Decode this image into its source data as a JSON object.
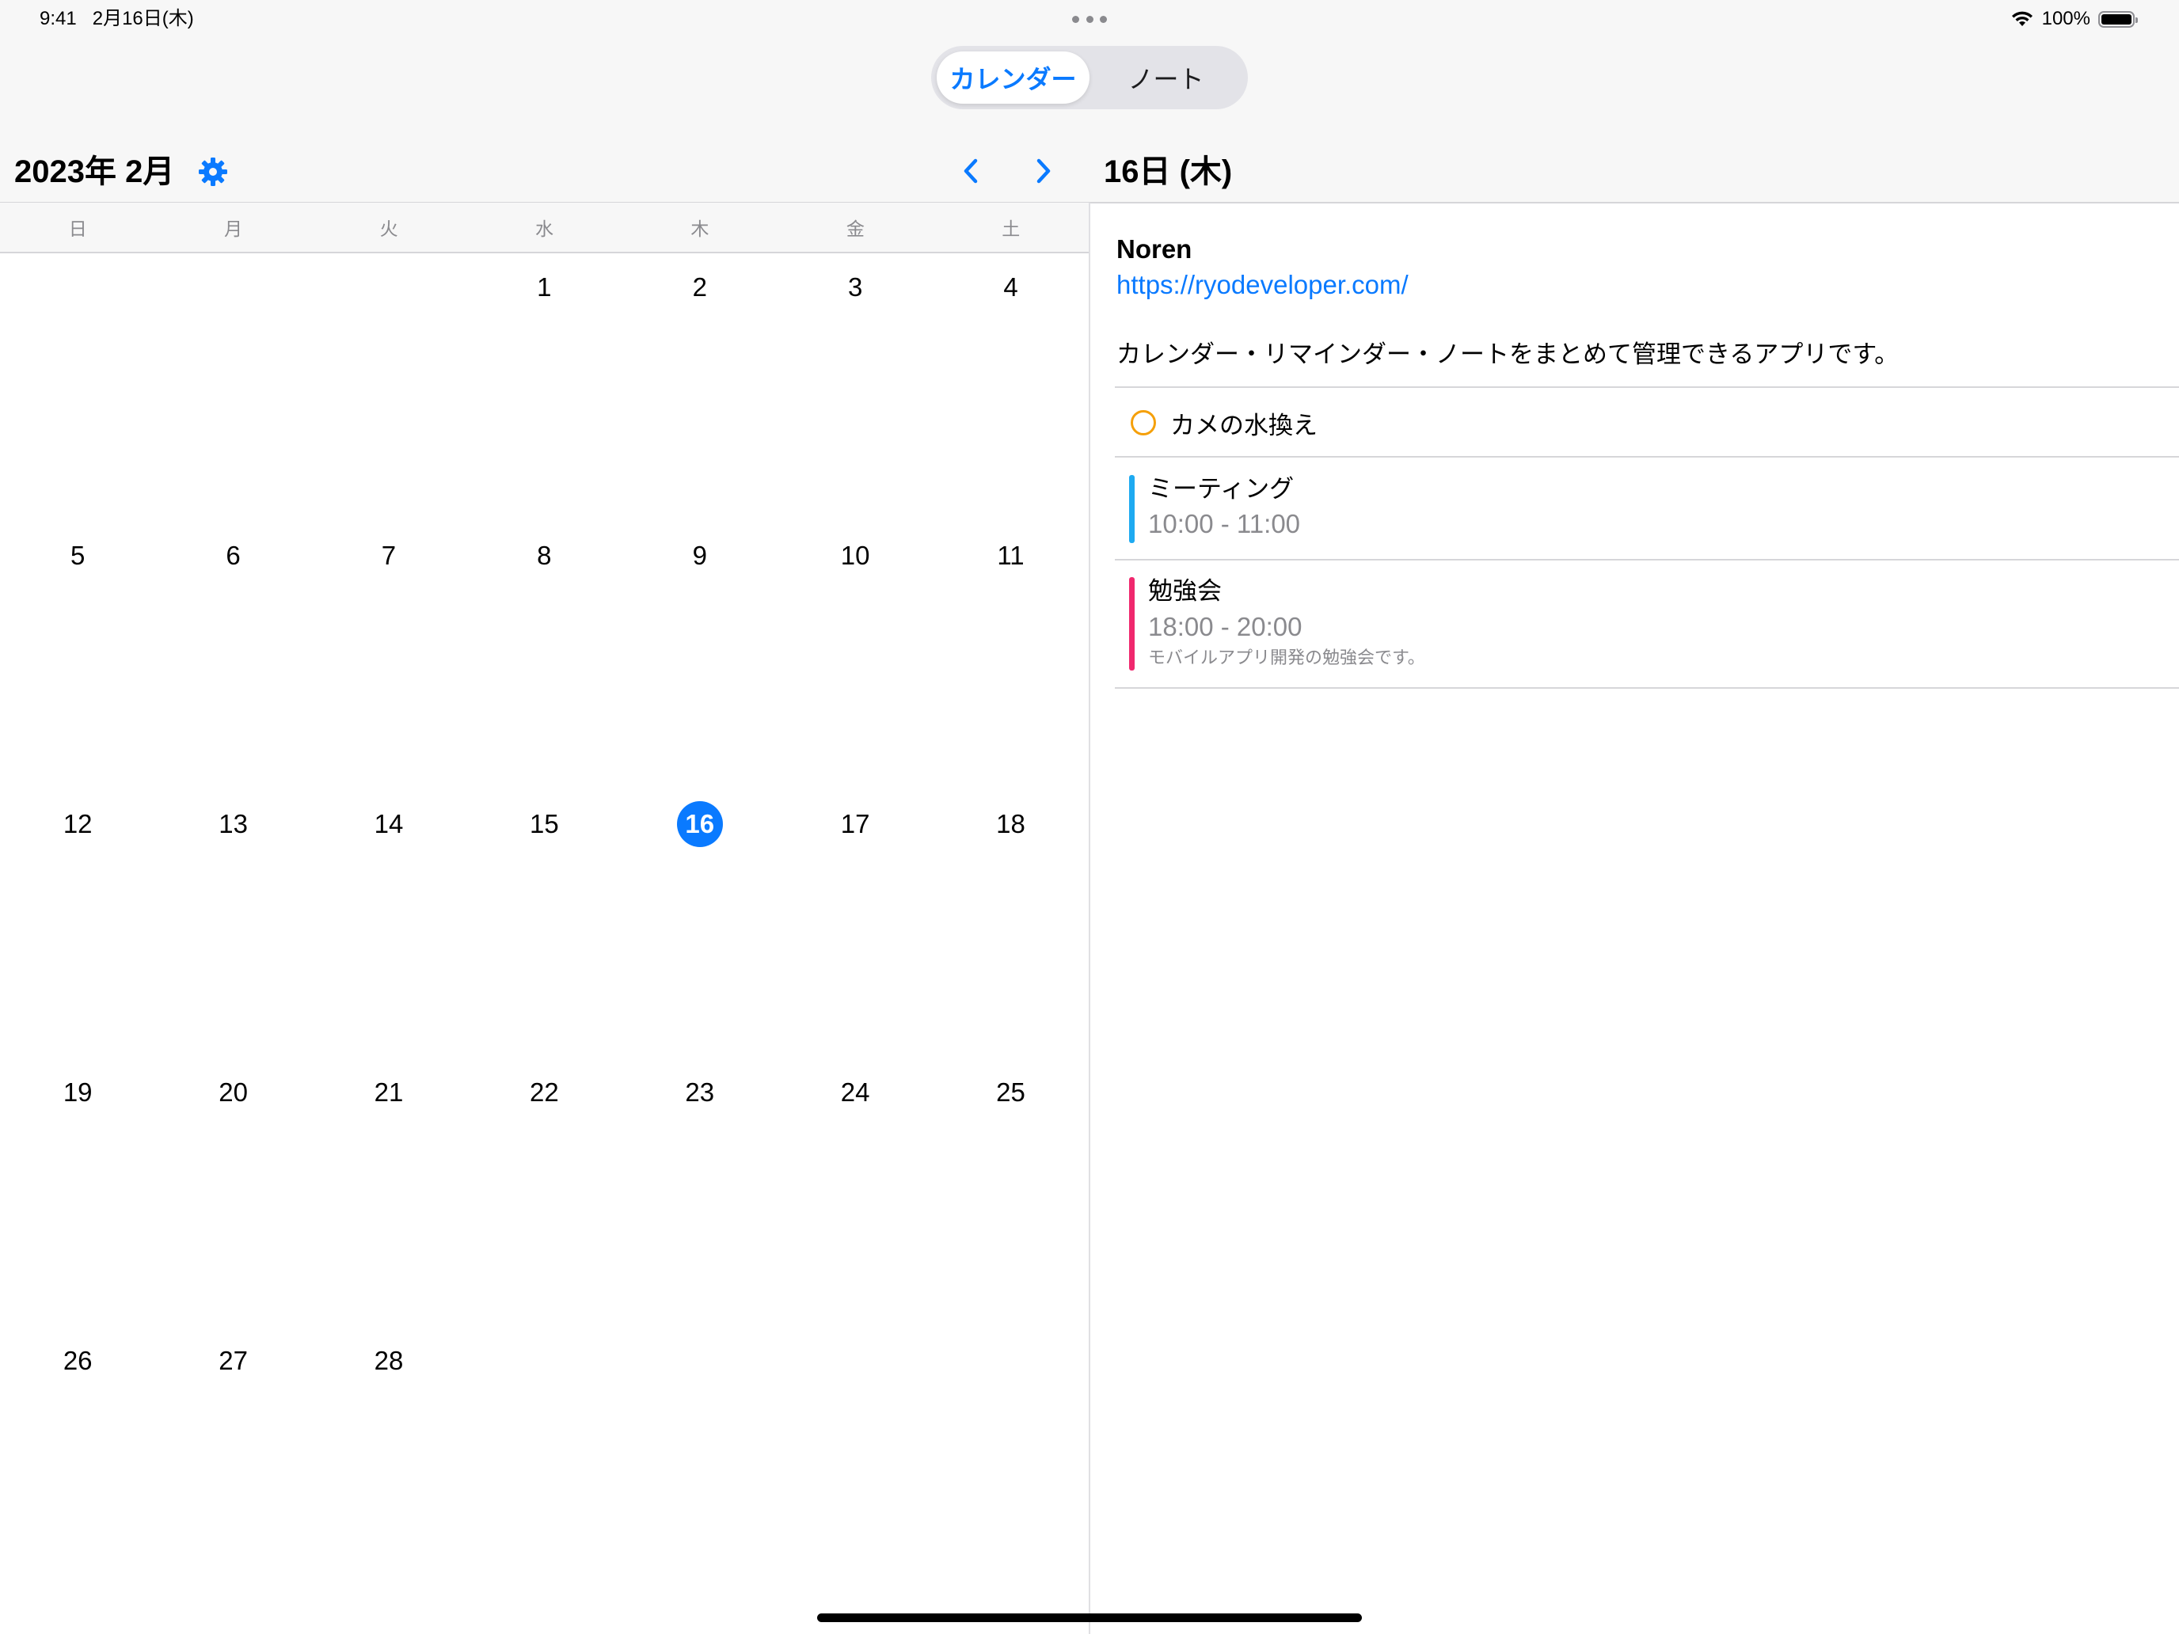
{
  "status_bar": {
    "time": "9:41",
    "date": "2月16日(木)",
    "battery": "100%",
    "battery_level": 1.0
  },
  "segmented_control": {
    "options": [
      "カレンダー",
      "ノート"
    ],
    "selected": "カレンダー"
  },
  "calendar": {
    "month_title": "2023年 2月",
    "weekdays": [
      "日",
      "月",
      "火",
      "水",
      "木",
      "金",
      "土"
    ],
    "weeks": [
      [
        "",
        "",
        "",
        "1",
        "2",
        "3",
        "4"
      ],
      [
        "5",
        "6",
        "7",
        "8",
        "9",
        "10",
        "11"
      ],
      [
        "12",
        "13",
        "14",
        "15",
        "16",
        "17",
        "18"
      ],
      [
        "19",
        "20",
        "21",
        "22",
        "23",
        "24",
        "25"
      ],
      [
        "26",
        "27",
        "28",
        "",
        "",
        "",
        ""
      ]
    ],
    "selected_day": "16"
  },
  "detail": {
    "date_title": "16日 (木)",
    "note": {
      "title": "Noren",
      "link": "https://ryodeveloper.com/",
      "description": "カレンダー・リマインダー・ノートをまとめて管理できるアプリです。"
    },
    "reminder": {
      "title": "カメの水換え",
      "color": "#f5a00a"
    },
    "events": [
      {
        "title": "ミーティング",
        "time": "10:00 - 11:00",
        "note": "",
        "color": "#1eaaf1"
      },
      {
        "title": "勉強会",
        "time": "18:00 - 20:00",
        "note": "モバイルアプリ開発の勉強会です。",
        "color": "#f0286e"
      }
    ]
  },
  "colors": {
    "accent": "#0a7aff",
    "separator": "#d6d6d9",
    "secondary_text": "#8a8a8e"
  },
  "icons": {
    "settings": "gear-icon",
    "prev": "chevron-left-icon",
    "next": "chevron-right-icon",
    "wifi": "wifi-icon",
    "battery": "battery-icon"
  }
}
